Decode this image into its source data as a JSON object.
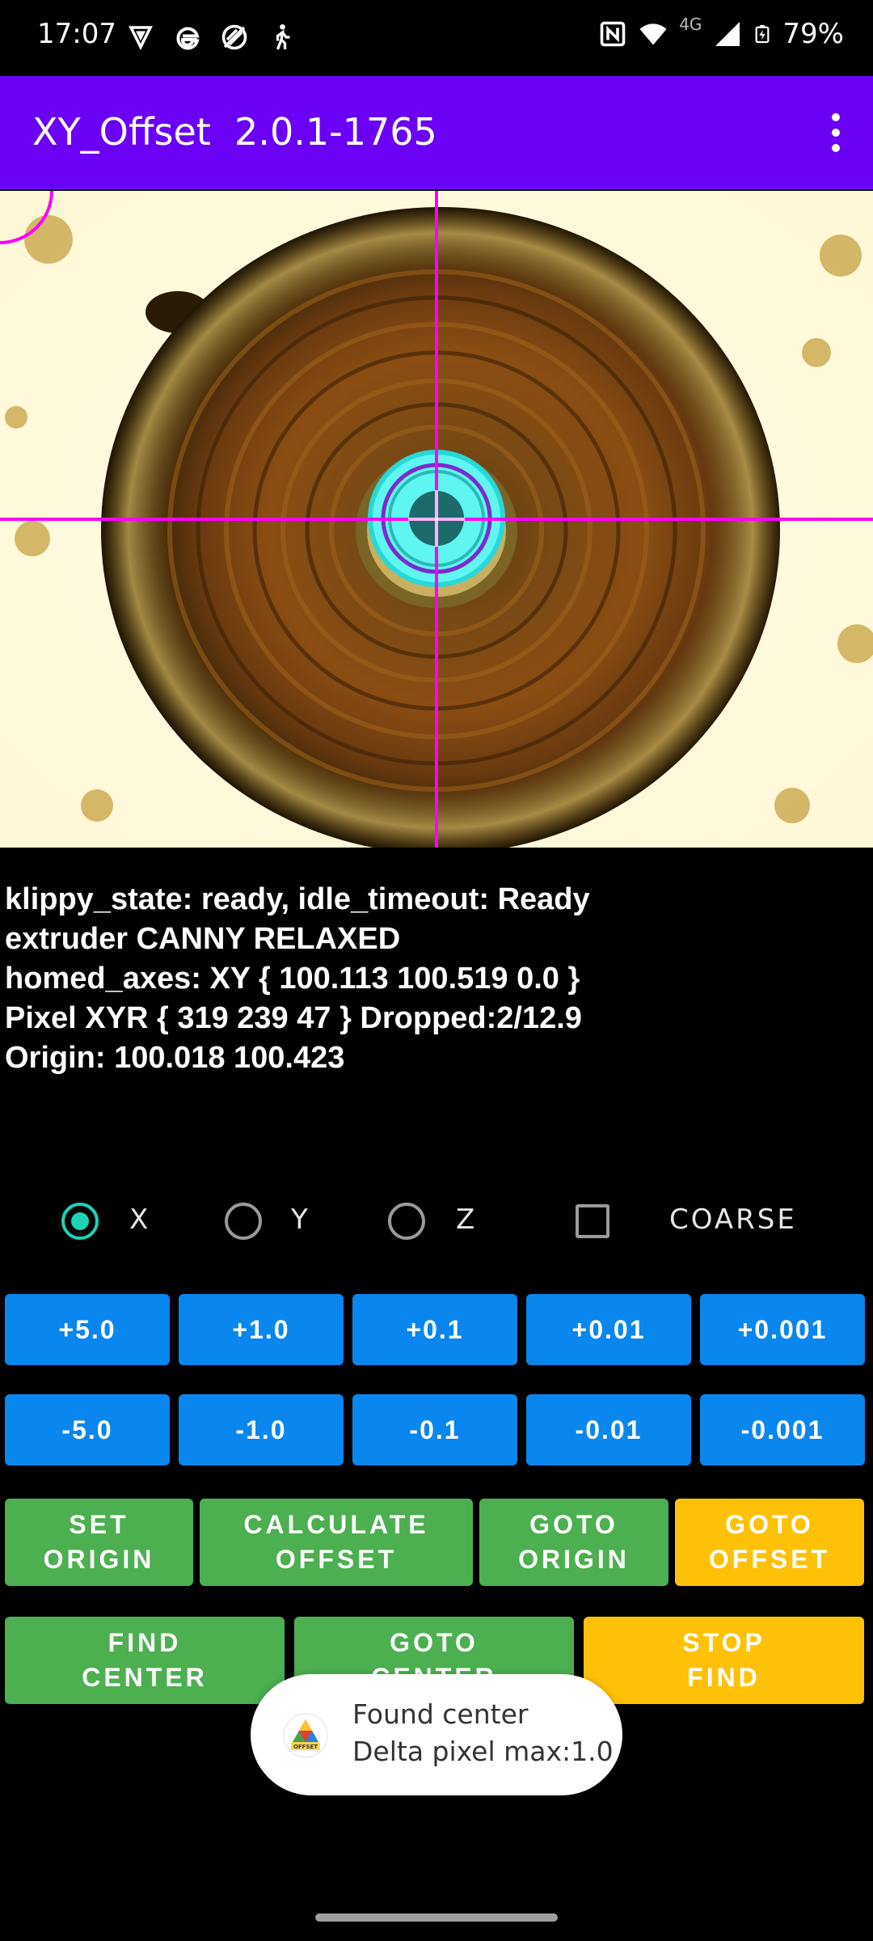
{
  "status_bar": {
    "time": "17:07",
    "network": "4G",
    "battery": "79%"
  },
  "app_bar": {
    "title": "XY_Offset  2.0.1-1765",
    "menu_icon": "more-vert-icon"
  },
  "colors": {
    "app_bar": "#6a00f4",
    "blue_button": "#0a86ef",
    "green_button": "#4caf50",
    "yellow_button": "#ffc107",
    "radio_accent": "#1fd1b5",
    "crosshair": "#ff00ff"
  },
  "info": {
    "line1": "klippy_state: ready, idle_timeout: Ready",
    "line2": "extruder CANNY RELAXED",
    "line3": "homed_axes: XY { 100.113 100.519 0.0 }",
    "line4": "Pixel XYR { 319 239 47 } Dropped:2/12.9",
    "line5": "Origin: 100.018 100.423"
  },
  "axis_select": {
    "options": [
      "X",
      "Y",
      "Z"
    ],
    "selected": "X",
    "coarse_label": "COARSE",
    "coarse_checked": false
  },
  "jog_plus": [
    "+5.0",
    "+1.0",
    "+0.1",
    "+0.01",
    "+0.001"
  ],
  "jog_minus": [
    "-5.0",
    "-1.0",
    "-0.1",
    "-0.01",
    "-0.001"
  ],
  "actions": {
    "set_origin": "SET\nORIGIN",
    "calculate_offset": "CALCULATE\nOFFSET",
    "goto_origin": "GOTO\nORIGIN",
    "goto_offset": "GOTO\nOFFSET",
    "find_center": "FIND\nCENTER",
    "goto_center": "GOTO\nCENTER",
    "stop_find": "STOP\nFIND"
  },
  "toast": {
    "line1": "Found center",
    "line2": "Delta pixel max:1.0",
    "icon_label": "OFFSET"
  }
}
